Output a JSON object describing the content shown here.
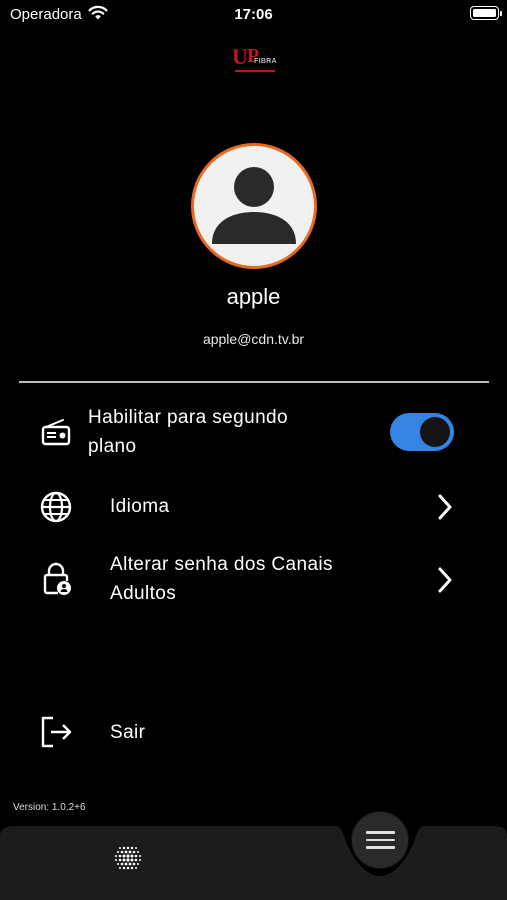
{
  "status_bar": {
    "carrier": "Operadora",
    "time": "17:06"
  },
  "logo": {
    "mark_u": "U",
    "mark_p": "P",
    "text": "FIBRA"
  },
  "profile": {
    "name": "apple",
    "email": "apple@cdn.tv.br"
  },
  "menu": {
    "background_play": {
      "label_line1": "Habilitar para segundo",
      "label_line2": "plano",
      "enabled": true,
      "icon": "radio-icon"
    },
    "language": {
      "label": "Idioma",
      "icon": "globe-icon"
    },
    "adult_password": {
      "label_line1": "Alterar senha dos Canais",
      "label_line2": "Adultos",
      "icon": "lock-user-icon"
    },
    "logout": {
      "label": "Sair",
      "icon": "logout-icon"
    }
  },
  "version": "Version: 1.0.2+6",
  "colors": {
    "accent": "#3584e4",
    "avatar_border": "#e66a1f",
    "brand_red": "#c4151c",
    "background": "#000000",
    "bar": "#1c1c1c"
  },
  "bottom_nav": {
    "left_icon": "dot-grid-icon",
    "center_icon": "hamburger-menu-icon"
  }
}
